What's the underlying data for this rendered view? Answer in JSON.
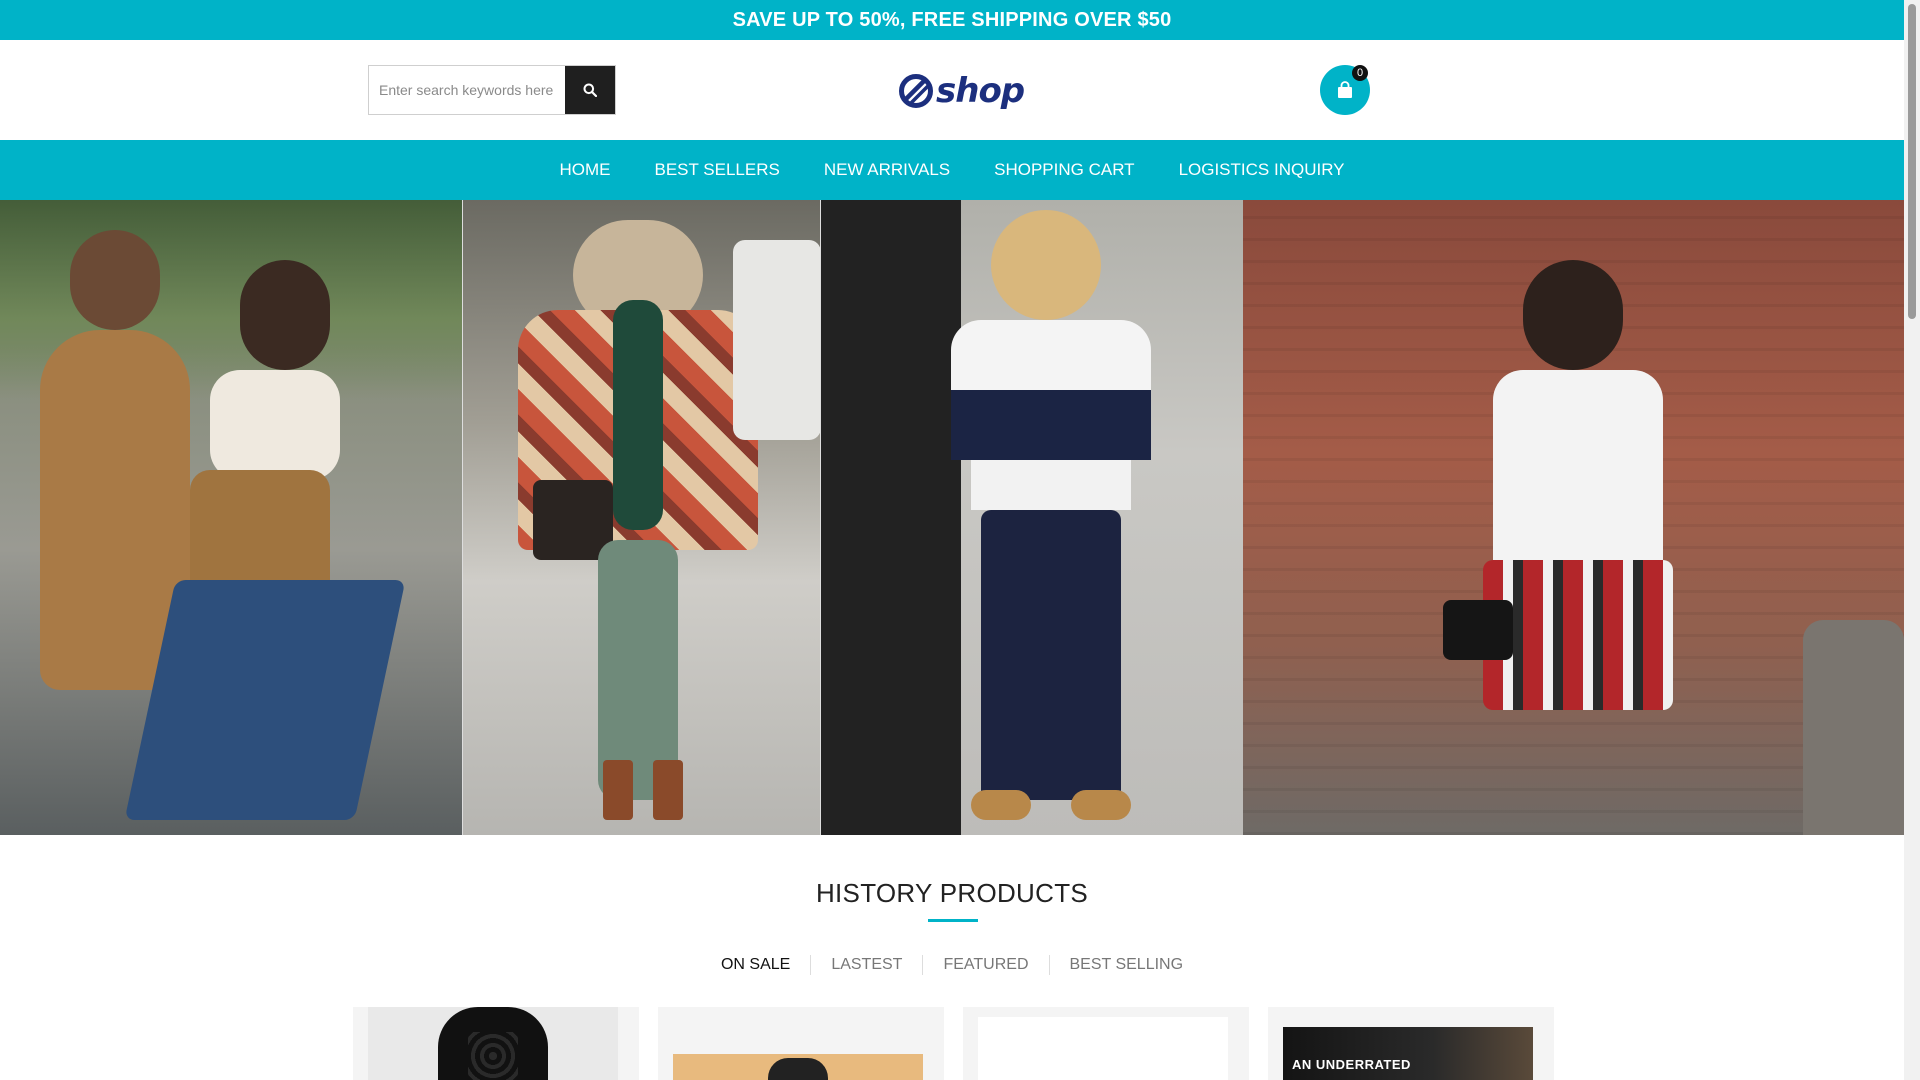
{
  "promo": {
    "text": "SAVE UP TO 50%, FREE SHIPPING OVER $50"
  },
  "header": {
    "search": {
      "placeholder": "Enter search keywords here",
      "button_icon": "search-icon"
    },
    "logo": {
      "text": "shop",
      "icon": "slashed-circle-logo-icon"
    },
    "cart": {
      "count": "0",
      "icon": "shopping-bag-icon"
    }
  },
  "nav": {
    "items": [
      {
        "label": "HOME"
      },
      {
        "label": "BEST SELLERS"
      },
      {
        "label": "NEW ARRIVALS"
      },
      {
        "label": "SHOPPING CART"
      },
      {
        "label": "LOGISTICS INQUIRY"
      }
    ]
  },
  "section": {
    "title": "HISTORY PRODUCTS"
  },
  "tabs": [
    {
      "label": "ON SALE",
      "active": true
    },
    {
      "label": "LASTEST",
      "active": false
    },
    {
      "label": "FEATURED",
      "active": false
    },
    {
      "label": "BEST SELLING",
      "active": false
    }
  ],
  "products": [
    {
      "banner_text": ""
    },
    {
      "banner_text": ""
    },
    {
      "banner_text": ""
    },
    {
      "banner_text": "AN UNDERRATED"
    }
  ],
  "colors": {
    "accent": "#00b3c8",
    "dark": "#1f1f1f",
    "logo": "#1c2f7e"
  }
}
